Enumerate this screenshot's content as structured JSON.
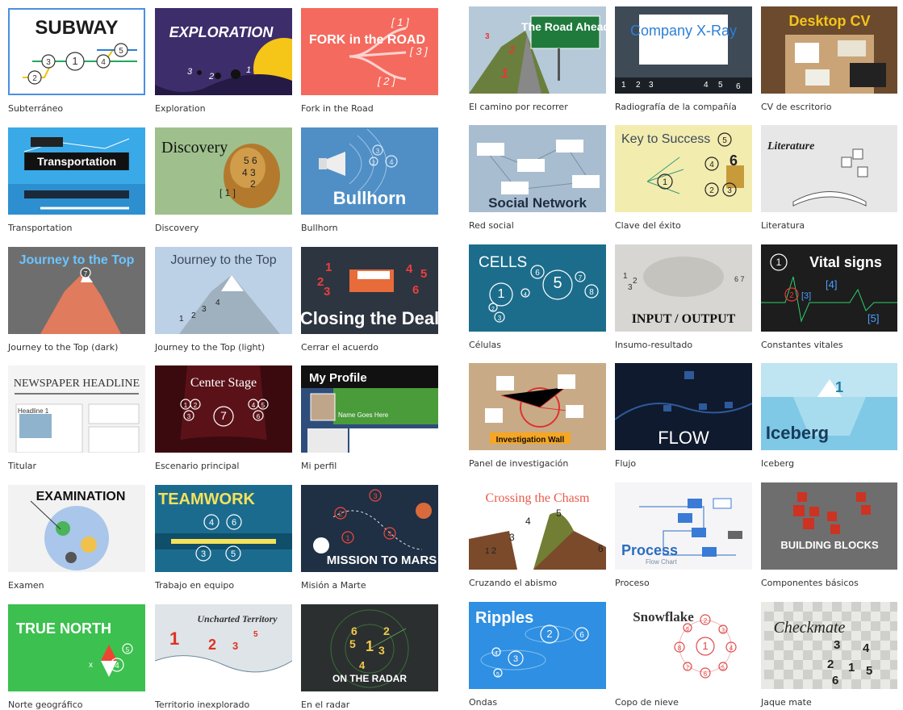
{
  "templates": [
    {
      "caption": "Subterráneo",
      "title": "SUBWAY",
      "bg": "#ffffff",
      "selected": true
    },
    {
      "caption": "Exploration",
      "title": "EXPLORATION",
      "bg": "#3d2d6b"
    },
    {
      "caption": "Fork in the Road",
      "title": "FORK in the ROAD",
      "bg": "#f56a5e"
    },
    {
      "caption": "Transportation",
      "title": "Transportation",
      "bg": "#39a9e8"
    },
    {
      "caption": "Discovery",
      "title": "Discovery",
      "bg": "#9fc08d"
    },
    {
      "caption": "Bullhorn",
      "title": "Bullhorn",
      "bg": "#4f8fc6"
    },
    {
      "caption": "Journey to the Top (dark)",
      "title": "Journey to the Top",
      "bg": "#6e6e6e"
    },
    {
      "caption": "Journey to the Top (light)",
      "title": "Journey to the Top",
      "bg": "#bcd0e6"
    },
    {
      "caption": "Cerrar el acuerdo",
      "title": "Closing the Deal",
      "bg": "#2d3540"
    },
    {
      "caption": "Titular",
      "title": "NEWSPAPER HEADLINE",
      "bg": "#f4f4f4"
    },
    {
      "caption": "Escenario principal",
      "title": "Center Stage",
      "bg": "#5a1218"
    },
    {
      "caption": "Mi perfil",
      "title": "My Profile",
      "bg": "#2e4d7b"
    },
    {
      "caption": "Examen",
      "title": "EXAMINATION",
      "bg": "#f2f2f2"
    },
    {
      "caption": "Trabajo en equipo",
      "title": "TEAMWORK",
      "bg": "#1b6b8f"
    },
    {
      "caption": "Misión a Marte",
      "title": "MISSION TO MARS",
      "bg": "#1f2f44"
    },
    {
      "caption": "Norte geográfico",
      "title": "TRUE NORTH",
      "bg": "#3cc04f"
    },
    {
      "caption": "Territorio inexplorado",
      "title": "Uncharted Territory",
      "bg": "#dfe4e8"
    },
    {
      "caption": "En el radar",
      "title": "ON THE RADAR",
      "bg": "#2b2f2f"
    },
    {
      "caption": "El camino por recorrer",
      "title": "The Road Ahead",
      "bg": "#b6c9d8"
    },
    {
      "caption": "Radiografía de la compañía",
      "title": "Company X-Ray",
      "bg": "#3f4a57"
    },
    {
      "caption": "CV de escritorio",
      "title": "Desktop CV",
      "bg": "#6b4a2e"
    },
    {
      "caption": "Red social",
      "title": "Social Network",
      "bg": "#a9bdd0"
    },
    {
      "caption": "Clave del éxito",
      "title": "Key to Success",
      "bg": "#f3ecaf"
    },
    {
      "caption": "Literatura",
      "title": "Literature",
      "bg": "#e7e7e7"
    },
    {
      "caption": "Células",
      "title": "CELLS",
      "bg": "#1c6d8c"
    },
    {
      "caption": "Insumo-resultado",
      "title": "INPUT / OUTPUT",
      "bg": "#d8d6d2"
    },
    {
      "caption": "Constantes vitales",
      "title": "Vital signs",
      "bg": "#1d1d1d"
    },
    {
      "caption": "Panel de investigación",
      "title": "Investigation Wall",
      "bg": "#c8ab86"
    },
    {
      "caption": "Flujo",
      "title": "FLOW",
      "bg": "#0f1a2e"
    },
    {
      "caption": "Iceberg",
      "title": "Iceberg",
      "bg": "#bfe4f2"
    },
    {
      "caption": "Cruzando el abismo",
      "title": "Crossing the Chasm",
      "bg": "#ffffff"
    },
    {
      "caption": "Proceso",
      "title": "Process",
      "bg": "#f5f5f7"
    },
    {
      "caption": "Componentes básicos",
      "title": "BUILDING BLOCKS",
      "bg": "#6e6e6e"
    },
    {
      "caption": "Ondas",
      "title": "Ripples",
      "bg": "#2f8fe2"
    },
    {
      "caption": "Copo de nieve",
      "title": "Snowflake",
      "bg": "#ffffff"
    },
    {
      "caption": "Jaque mate",
      "title": "Checkmate",
      "bg": "#e9e9e6"
    }
  ],
  "extra": {
    "process_sub": "Flow Chart",
    "profile_name": "Name Goes Here",
    "subway_nums": [
      "1",
      "2",
      "3",
      "4",
      "5"
    ],
    "news_small": "Headline 1"
  }
}
